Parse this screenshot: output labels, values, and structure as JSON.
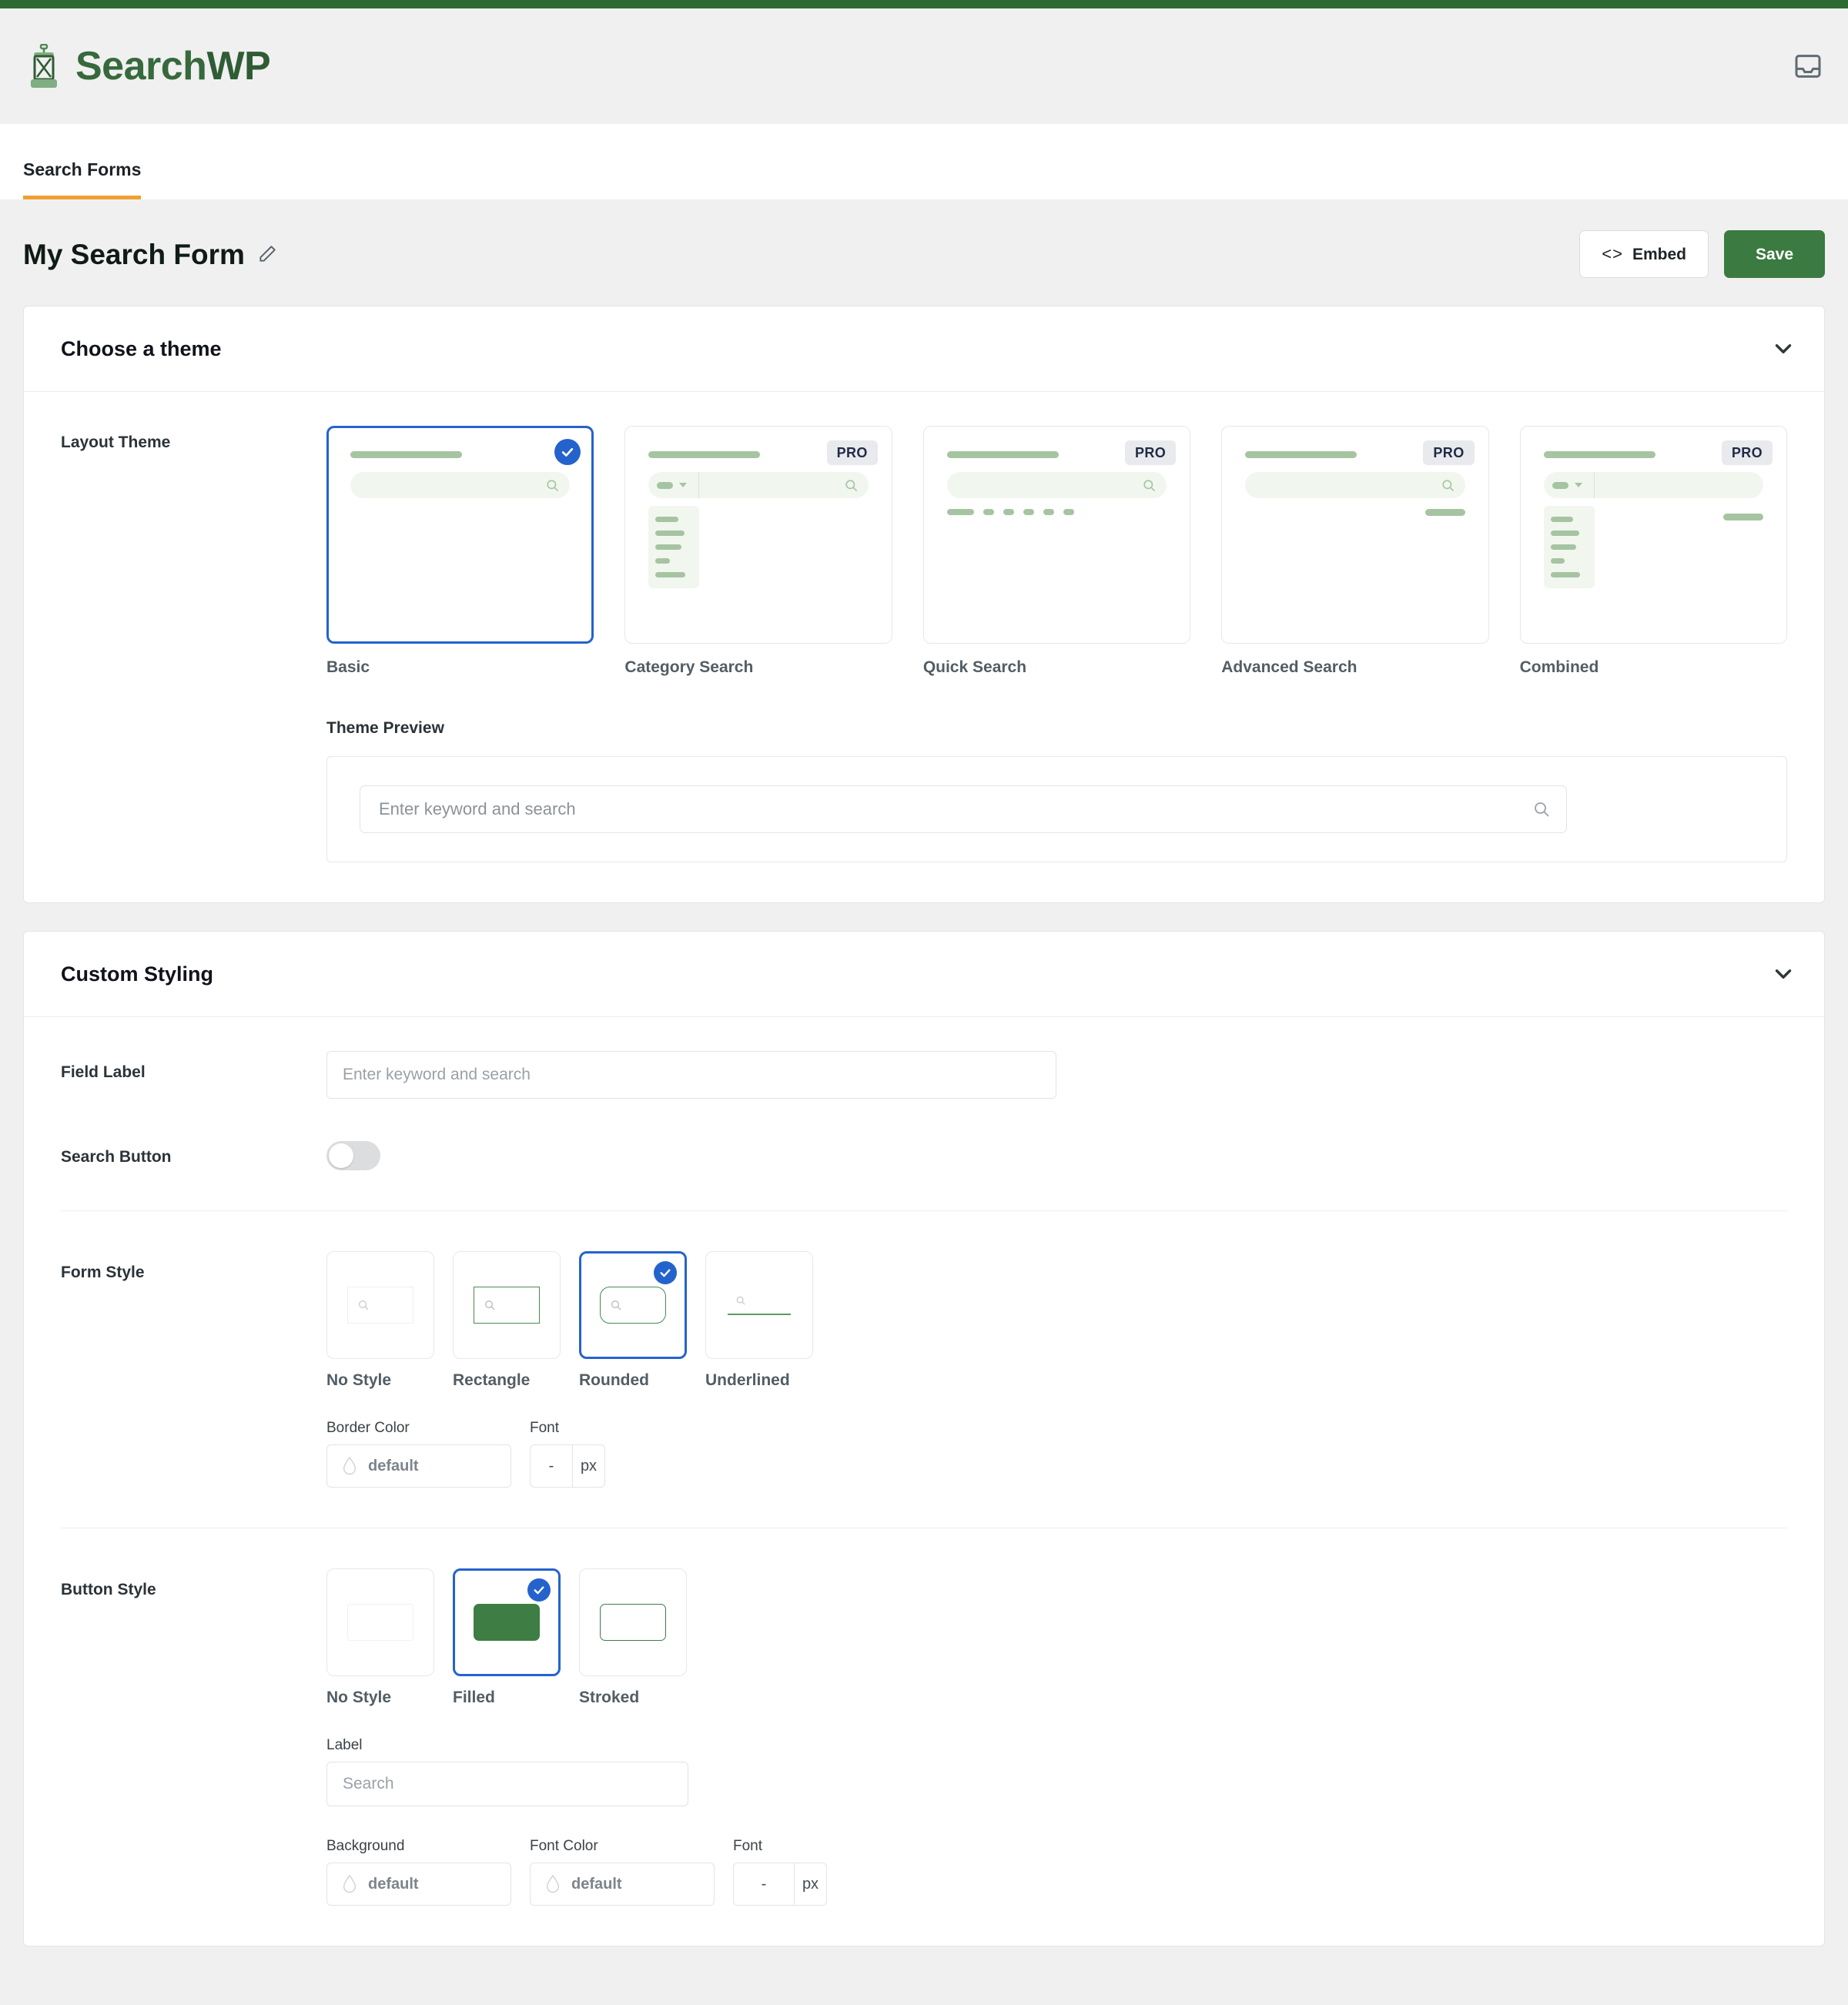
{
  "brand": {
    "name_primary": "Search",
    "name_secondary": "WP",
    "inbox_icon": "inbox-icon",
    "logo_icon": "lantern-logo-icon"
  },
  "tabs": [
    {
      "label": "Search Forms",
      "active": true
    }
  ],
  "title_row": {
    "title": "My Search Form",
    "edit_icon": "pencil-icon",
    "embed_label": "Embed",
    "embed_glyph": "<>",
    "save_label": "Save"
  },
  "theme_panel": {
    "heading": "Choose a theme",
    "chevron_icon": "chevron-down-icon",
    "layout_theme_label": "Layout Theme",
    "themes": [
      {
        "name": "Basic",
        "pro": false,
        "selected": true,
        "variant": "basic"
      },
      {
        "name": "Category Search",
        "pro": true,
        "pro_label": "PRO",
        "selected": false,
        "variant": "category"
      },
      {
        "name": "Quick Search",
        "pro": true,
        "pro_label": "PRO",
        "selected": false,
        "variant": "quick"
      },
      {
        "name": "Advanced Search",
        "pro": true,
        "pro_label": "PRO",
        "selected": false,
        "variant": "advanced"
      },
      {
        "name": "Combined",
        "pro": true,
        "pro_label": "PRO",
        "selected": false,
        "variant": "combined"
      }
    ],
    "preview_title": "Theme Preview",
    "preview_placeholder": "Enter keyword and search",
    "preview_search_icon": "search-icon"
  },
  "styling_panel": {
    "heading": "Custom Styling",
    "chevron_icon": "chevron-down-icon",
    "field_label": {
      "label": "Field Label",
      "placeholder": "Enter keyword and search",
      "value": ""
    },
    "search_button": {
      "label": "Search Button",
      "enabled": false
    },
    "form_style": {
      "label": "Form Style",
      "options": [
        {
          "name": "No Style",
          "selected": false,
          "variant": "nostyle"
        },
        {
          "name": "Rectangle",
          "selected": false,
          "variant": "rect"
        },
        {
          "name": "Rounded",
          "selected": true,
          "variant": "round"
        },
        {
          "name": "Underlined",
          "selected": false,
          "variant": "under"
        }
      ],
      "border_color": {
        "label": "Border Color",
        "value": "default",
        "icon": "color-droplet-icon"
      },
      "font": {
        "label": "Font",
        "value": "-",
        "unit": "px"
      }
    },
    "button_style": {
      "label": "Button Style",
      "options": [
        {
          "name": "No Style",
          "selected": false,
          "variant": "nostyle"
        },
        {
          "name": "Filled",
          "selected": true,
          "variant": "filled"
        },
        {
          "name": "Stroked",
          "selected": false,
          "variant": "stroked"
        }
      ],
      "button_label": {
        "label": "Label",
        "placeholder": "Search",
        "value": ""
      },
      "background": {
        "label": "Background",
        "value": "default",
        "icon": "color-droplet-icon"
      },
      "font_color": {
        "label": "Font Color",
        "value": "default",
        "icon": "color-droplet-icon"
      },
      "font": {
        "label": "Font",
        "value": "-",
        "unit": "px"
      }
    }
  },
  "colors": {
    "brand_green": "#36693b",
    "top_strip": "#2e6b33",
    "tab_underline": "#f0a030",
    "save_button": "#3b7a40",
    "selected_border": "#2563cc",
    "page_bg": "#f0f0f1"
  }
}
